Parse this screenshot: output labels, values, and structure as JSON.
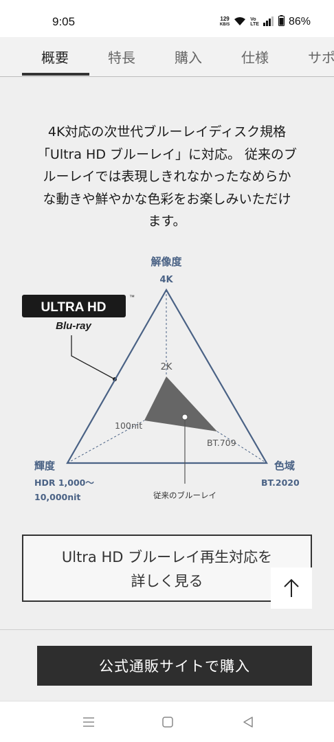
{
  "status_bar": {
    "time": "9:05",
    "net_speed_value": "129",
    "net_speed_unit": "KB/S",
    "battery": "86%"
  },
  "tabs": [
    {
      "label": "概要",
      "active": true
    },
    {
      "label": "特長",
      "active": false
    },
    {
      "label": "購入",
      "active": false
    },
    {
      "label": "仕様",
      "active": false
    },
    {
      "label": "サポ",
      "active": false
    }
  ],
  "intro": {
    "line1": "4K対応の次世代ブルーレイディスク規格",
    "line2": "「Ultra HD ブルーレイ」に対応。 従来のブ",
    "line3": "ルーレイでは表現しきれなかったなめらか",
    "line4": "な動きや鮮やかな色彩をお楽しみいただけ",
    "line5": "ます。"
  },
  "diagram": {
    "logo_main": "ULTRA HD",
    "logo_sub": "Blu-ray",
    "logo_tm": "™",
    "top_label": "解像度",
    "top_value": "4K",
    "inner_top": "2K",
    "inner_left": "100nit",
    "inner_right": "BT.709",
    "left_label": "輝度",
    "left_value_line1": "HDR 1,000〜",
    "left_value_line2": "10,000nit",
    "right_label": "色域",
    "right_value": "BT.2020",
    "legacy_label": "従来のブルーレイ",
    "colors": {
      "axis": "#4a6285",
      "inner": "#666666",
      "label": "#4a6285"
    }
  },
  "cta": {
    "line1": "Ultra HD ブルーレイ再生対応を",
    "line2": "詳しく見る"
  },
  "buy_button": "公式通販サイトで購入"
}
